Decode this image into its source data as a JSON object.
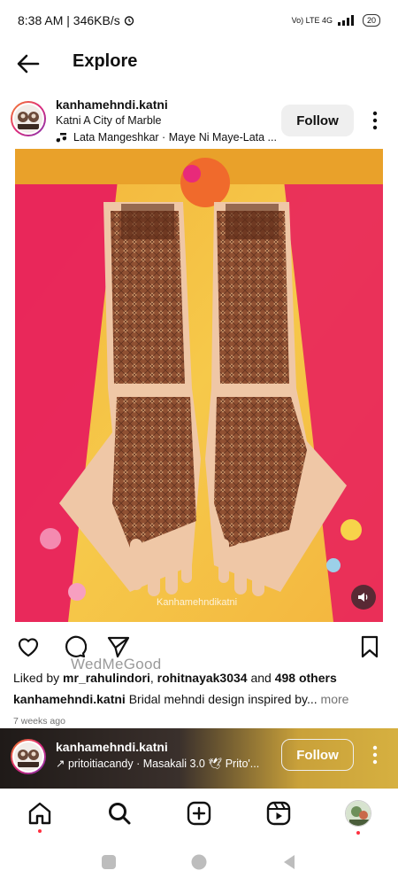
{
  "status_bar": {
    "time_speed": "8:38 AM | 346KB/s",
    "network": "Vo) LTE 4G",
    "battery": "20"
  },
  "header": {
    "title": "Explore"
  },
  "post": {
    "username": "kanhamehndi.katni",
    "location": "Katni A City of Marble",
    "audio": "Lata Mangeshkar · Maye Ni Maye-Lata ...",
    "follow_label": "Follow",
    "image_watermark": "Kanhamehndikatni",
    "watermark": "WedMeGood",
    "likes_prefix": "Liked by ",
    "liked_user_1": "mr_rahulindori",
    "liked_sep": ", ",
    "liked_user_2": "rohitnayak3034",
    "liked_and": " and ",
    "liked_others": "498 others",
    "caption_user": "kanhamehndi.katni",
    "caption_text": " Bridal mehndi design inspired by...",
    "caption_more": " more",
    "time": "7 weeks ago"
  },
  "next_post": {
    "username": "kanhamehndi.katni",
    "audio": "↗ pritoitiacandy · Masakali 3.0 🕊 Prito'...",
    "follow_label": "Follow"
  },
  "icons": {
    "back": "arrow-left-icon",
    "music": "music-note-icon",
    "more": "more-vertical-icon",
    "like": "heart-icon",
    "comment": "comment-icon",
    "share": "send-icon",
    "save": "bookmark-icon",
    "sound": "speaker-icon",
    "home": "home-icon",
    "search": "search-icon",
    "create": "plus-square-icon",
    "reels": "reels-icon",
    "profile": "profile-avatar-icon"
  },
  "colors": {
    "notification_dot": "#ff3040",
    "text_secondary": "#737373",
    "follow_bg": "#efefef"
  }
}
